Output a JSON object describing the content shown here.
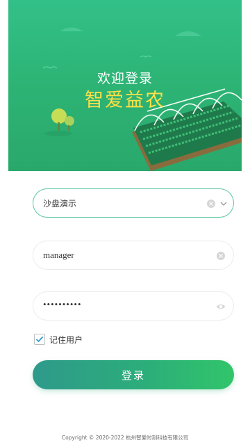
{
  "hero": {
    "welcome": "欢迎登录",
    "brand": "智爱益农"
  },
  "form": {
    "tenant": {
      "value": "沙盘演示",
      "icons": [
        "clear-icon",
        "chevron-down-icon"
      ]
    },
    "username": {
      "value": "manager",
      "icons": [
        "clear-icon"
      ]
    },
    "password": {
      "value": "••••••••••",
      "icons": [
        "eye-icon"
      ]
    },
    "remember": {
      "label": "记住用户",
      "checked": true
    },
    "submit_label": "登录"
  },
  "footer": {
    "copyright": "Copyright © 2020-2022 杭州智爱时刻科技有限公司"
  },
  "colors": {
    "hero_bg": "#2db576",
    "brand_text": "#ffe046",
    "accent": "#2cad7a",
    "active_border": "#5cc79e"
  }
}
